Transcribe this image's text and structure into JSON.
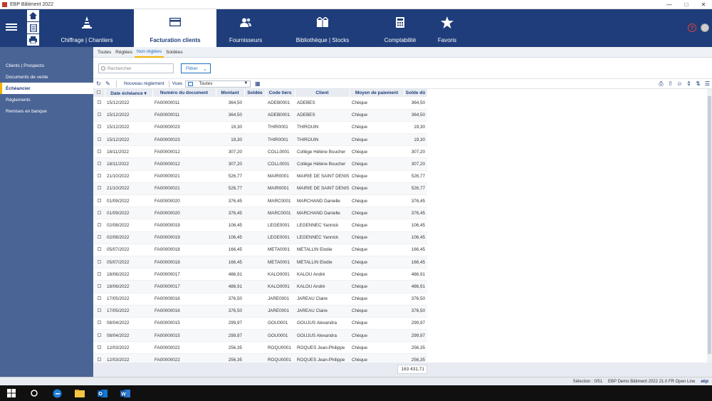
{
  "window": {
    "title": "EBP Bâtiment 2022"
  },
  "ribbon": {
    "tabs": [
      {
        "label": "Chiffrage | Chantiers",
        "icon": "cone-icon"
      },
      {
        "label": "Facturation clients",
        "icon": "card-icon",
        "active": true
      },
      {
        "label": "Fournisseurs",
        "icon": "people-icon"
      },
      {
        "label": "Bibliothèque | Stocks",
        "icon": "boxes-icon"
      },
      {
        "label": "Comptabilité",
        "icon": "calculator-icon"
      },
      {
        "label": "Favoris",
        "icon": "star-icon"
      }
    ]
  },
  "sidebar": {
    "items": [
      {
        "label": "Clients | Prospects"
      },
      {
        "label": "Documents de vente"
      },
      {
        "label": "Échéancier",
        "active": true
      },
      {
        "label": "Règlements"
      },
      {
        "label": "Remises en banque"
      }
    ]
  },
  "filter_tabs": [
    "Toutes",
    "Réglées",
    "Non réglées",
    "Soldées"
  ],
  "filter_active": "Non réglées",
  "search": {
    "placeholder": "Rechercher"
  },
  "filter_button": "Filtrer",
  "toolbar": {
    "new_payment": "Nouveau règlement",
    "views_label": "Vues",
    "views_value": "Toutes"
  },
  "table": {
    "columns": [
      "Date échéance",
      "Numéro du document",
      "Montant",
      "Soldée",
      "Code tiers",
      "Client",
      "Moyen de paiement",
      "Solde dû"
    ],
    "rows": [
      [
        "15/12/2022",
        "FA00000011",
        "364,50",
        "",
        "ADEB0001",
        "ADEBES",
        "Chèque",
        "364,50"
      ],
      [
        "15/12/2022",
        "FA00000011",
        "364,50",
        "",
        "ADEB0001",
        "ADEBES",
        "Chèque",
        "364,50"
      ],
      [
        "15/12/2022",
        "FA00000023",
        "19,30",
        "",
        "THIR0001",
        "THIROUIN",
        "Chèque",
        "19,30"
      ],
      [
        "15/12/2022",
        "FA00000023",
        "19,30",
        "",
        "THIR0001",
        "THIROUIN",
        "Chèque",
        "19,30"
      ],
      [
        "18/11/2022",
        "FA00000012",
        "307,20",
        "",
        "COLL0001",
        "Collège Hélène Boucher",
        "Chèque",
        "307,20"
      ],
      [
        "18/11/2022",
        "FA00000012",
        "307,20",
        "",
        "COLL0001",
        "Collège Hélène Boucher",
        "Chèque",
        "307,20"
      ],
      [
        "21/10/2022",
        "FA00000021",
        "526,77",
        "",
        "MAIR0001",
        "MAIRIE DE SAINT DENIS",
        "Chèque",
        "526,77"
      ],
      [
        "21/10/2022",
        "FA00000021",
        "526,77",
        "",
        "MAIR0001",
        "MAIRIE DE SAINT DENIS",
        "Chèque",
        "526,77"
      ],
      [
        "01/09/2022",
        "FA00000020",
        "376,45",
        "",
        "MARC0001",
        "MARCHAND Danielle",
        "Chèque",
        "376,45"
      ],
      [
        "01/09/2022",
        "FA00000020",
        "376,45",
        "",
        "MARC0001",
        "MARCHAND Danielle",
        "Chèque",
        "376,45"
      ],
      [
        "02/08/2022",
        "FA00000019",
        "106,45",
        "",
        "LEGE0001",
        "LEGENNEC Yannick",
        "Chèque",
        "106,45"
      ],
      [
        "02/08/2022",
        "FA00000019",
        "106,45",
        "",
        "LEGE0001",
        "LEGENNEC Yannick",
        "Chèque",
        "106,45"
      ],
      [
        "05/07/2022",
        "FA00000018",
        "166,45",
        "",
        "META0001",
        "METALLIN Elodie",
        "Chèque",
        "166,45"
      ],
      [
        "05/07/2022",
        "FA00000018",
        "166,45",
        "",
        "META0001",
        "METALLIN Elodie",
        "Chèque",
        "166,45"
      ],
      [
        "18/06/2022",
        "FA00000017",
        "486,91",
        "",
        "KALO0001",
        "KALOU André",
        "Chèque",
        "486,91"
      ],
      [
        "18/06/2022",
        "FA00000017",
        "486,91",
        "",
        "KALO0001",
        "KALOU André",
        "Chèque",
        "486,91"
      ],
      [
        "17/05/2022",
        "FA00000016",
        "376,50",
        "",
        "JARE0001",
        "JAREAU Claire",
        "Chèque",
        "376,50"
      ],
      [
        "17/05/2022",
        "FA00000016",
        "376,50",
        "",
        "JARE0001",
        "JAREAU Claire",
        "Chèque",
        "376,50"
      ],
      [
        "08/04/2022",
        "FA00000015",
        "299,97",
        "",
        "GOU0001",
        "GOUJUS Alexandra",
        "Chèque",
        "299,97"
      ],
      [
        "08/04/2022",
        "FA00000015",
        "299,97",
        "",
        "GOU0001",
        "GOUJUS Alexandra",
        "Chèque",
        "299,97"
      ],
      [
        "12/03/2022",
        "FA00000022",
        "256,35",
        "",
        "ROQU0001",
        "ROQUES Jean-Philippe",
        "Chèque",
        "256,35"
      ],
      [
        "12/03/2022",
        "FA00000022",
        "256,35",
        "",
        "ROQU0001",
        "ROQUES Jean-Philippe",
        "Chèque",
        "256,35"
      ]
    ],
    "total": "163 431,71"
  },
  "status": {
    "selection": "Sélection : 0/51",
    "version": "EBP Demo Bâtiment 2022 21.0 FR Open Line",
    "logo": "ebp"
  },
  "colors": {
    "ribbon": "#1e3d7a",
    "sidebar": "#4a6496",
    "accent": "#f0b000"
  }
}
